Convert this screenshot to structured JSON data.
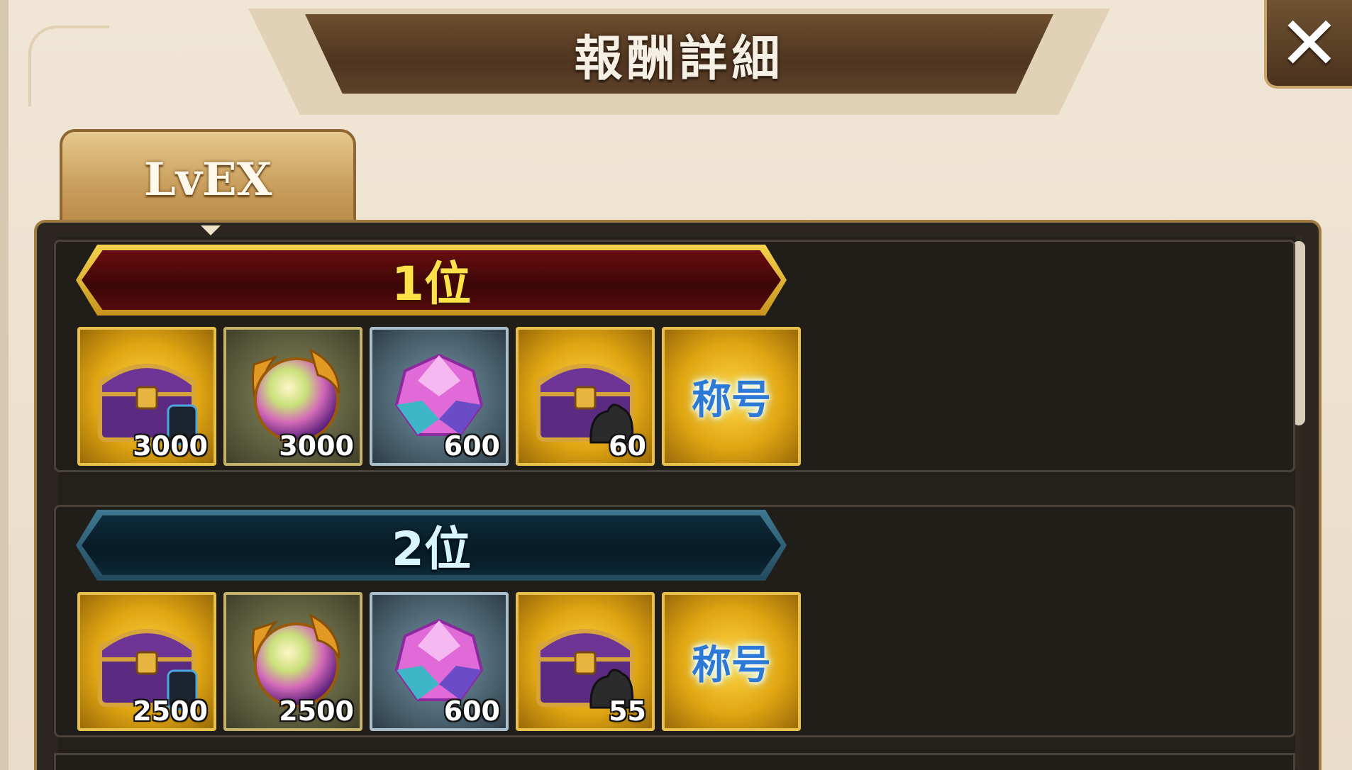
{
  "header": {
    "title": "報酬詳細",
    "close_label": "✕"
  },
  "tab": {
    "label": "LvEX"
  },
  "ranks": [
    {
      "label": "1位",
      "items": [
        {
          "icon": "chest-icon",
          "quantity": "3000"
        },
        {
          "icon": "dragon-orb-icon",
          "quantity": "3000"
        },
        {
          "icon": "crystal-gem-icon",
          "quantity": "600"
        },
        {
          "icon": "chest-icon",
          "quantity": "60"
        },
        {
          "icon": "title-badge-icon",
          "badge_text": "称号"
        }
      ]
    },
    {
      "label": "2位",
      "items": [
        {
          "icon": "chest-icon",
          "quantity": "2500"
        },
        {
          "icon": "dragon-orb-icon",
          "quantity": "2500"
        },
        {
          "icon": "crystal-gem-icon",
          "quantity": "600"
        },
        {
          "icon": "chest-icon",
          "quantity": "55"
        },
        {
          "icon": "title-badge-icon",
          "badge_text": "称号"
        }
      ]
    }
  ],
  "colors": {
    "rank1_border": "#f5d34c",
    "rank1_fill": "#5a0a0c",
    "rank2_border": "#3f7891",
    "rank2_fill": "#0a2230",
    "panel_bg": "#24211c"
  }
}
